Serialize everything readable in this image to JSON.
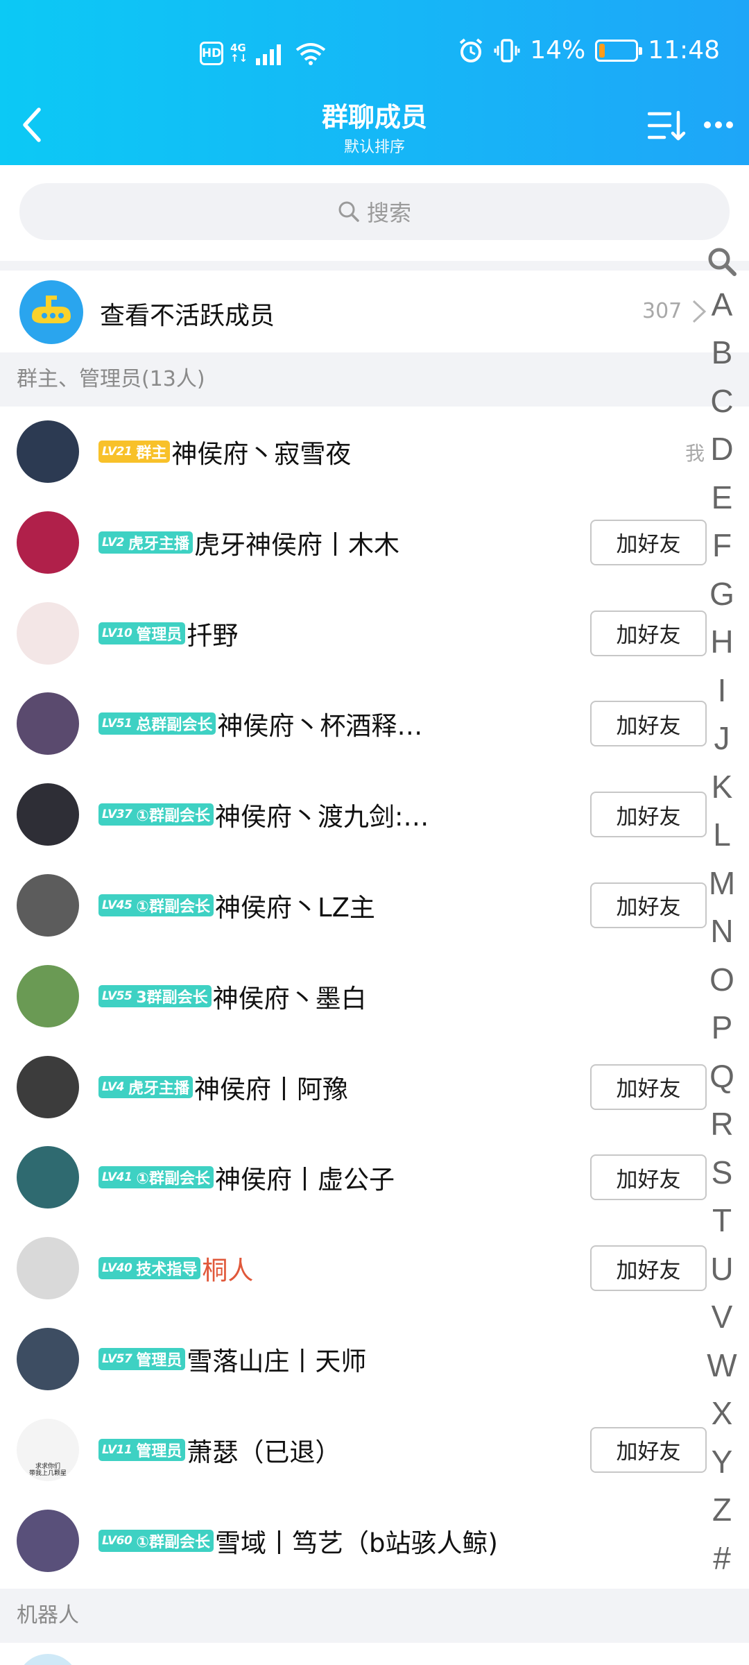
{
  "status_bar": {
    "hd": "HD",
    "network": "4G",
    "battery_percent": "14%",
    "battery_level": 0.14,
    "time": "11:48",
    "battery_color": "#ff9c1a"
  },
  "nav": {
    "title": "群聊成员",
    "subtitle": "默认排序",
    "back_icon": "chevron-left-icon",
    "sort_icon": "sort-list-icon",
    "more_icon": "more-dots-icon"
  },
  "search": {
    "placeholder": "搜索",
    "icon": "search-icon"
  },
  "inactive": {
    "label": "查看不活跃成员",
    "count": "307"
  },
  "sections": {
    "admins": "群主、管理员(13人)",
    "bots": "机器人"
  },
  "members": [
    {
      "level": "LV21",
      "role": "群主",
      "role_type": "owner",
      "name": "神侯府丶寂雪夜",
      "me": "我",
      "add_friend": "",
      "avatar_color": "#2c3a52"
    },
    {
      "level": "LV2",
      "role": "虎牙主播",
      "role_type": "admin",
      "name": "虎牙神侯府丨木木",
      "me": "",
      "add_friend": "加好友",
      "avatar_color": "#b0204a"
    },
    {
      "level": "LV10",
      "role": "管理员",
      "role_type": "admin",
      "name": "扦野",
      "me": "",
      "add_friend": "加好友",
      "avatar_color": "#f3e6e6"
    },
    {
      "level": "LV51",
      "role": "总群副会长",
      "role_type": "admin",
      "name": "神侯府丶杯酒释…",
      "me": "",
      "add_friend": "加好友",
      "avatar_color": "#5a4a6e"
    },
    {
      "level": "LV37",
      "role": "①群副会长",
      "role_type": "admin",
      "name": "神侯府丶渡九剑:…",
      "me": "",
      "add_friend": "加好友",
      "avatar_color": "#2e2e36"
    },
    {
      "level": "LV45",
      "role": "①群副会长",
      "role_type": "admin",
      "name": "神侯府丶LZ主",
      "me": "",
      "add_friend": "加好友",
      "avatar_color": "#5c5c5c"
    },
    {
      "level": "LV55",
      "role": "3群副会长",
      "role_type": "admin",
      "name": "神侯府丶墨白",
      "me": "",
      "add_friend": "",
      "avatar_color": "#6a9a54"
    },
    {
      "level": "LV4",
      "role": "虎牙主播",
      "role_type": "admin",
      "name": "神侯府丨阿豫",
      "me": "",
      "add_friend": "加好友",
      "avatar_color": "#3c3c3c"
    },
    {
      "level": "LV41",
      "role": "①群副会长",
      "role_type": "admin",
      "name": "神侯府丨虚公子",
      "me": "",
      "add_friend": "加好友",
      "avatar_color": "#2f6a70"
    },
    {
      "level": "LV40",
      "role": "技术指导",
      "role_type": "admin",
      "name": "桐人",
      "name_color": "red",
      "me": "",
      "add_friend": "加好友",
      "avatar_color": "#d9d9d9"
    },
    {
      "level": "LV57",
      "role": "管理员",
      "role_type": "admin",
      "name": "雪落山庄丨天师",
      "me": "",
      "add_friend": "",
      "avatar_color": "#3d4d62"
    },
    {
      "level": "LV11",
      "role": "管理员",
      "role_type": "admin",
      "name": "萧瑟（已退）",
      "me": "",
      "add_friend": "加好友",
      "avatar_color": "#f4f4f4",
      "avatar_text": "求求你们\n带我上几颗星"
    },
    {
      "level": "LV60",
      "role": "①群副会长",
      "role_type": "admin",
      "name": "雪域丨笃艺（b站骇人鲸)",
      "me": "",
      "add_friend": "",
      "avatar_color": "#59507a"
    }
  ],
  "alphabet": [
    "A",
    "B",
    "C",
    "D",
    "E",
    "F",
    "G",
    "H",
    "I",
    "J",
    "K",
    "L",
    "M",
    "N",
    "O",
    "P",
    "Q",
    "R",
    "S",
    "T",
    "U",
    "V",
    "W",
    "X",
    "Y",
    "Z",
    "#"
  ],
  "colors": {
    "owner_badge": "#f8c12a",
    "admin_badge": "#3ed1c3",
    "header": "#16b6f7"
  }
}
